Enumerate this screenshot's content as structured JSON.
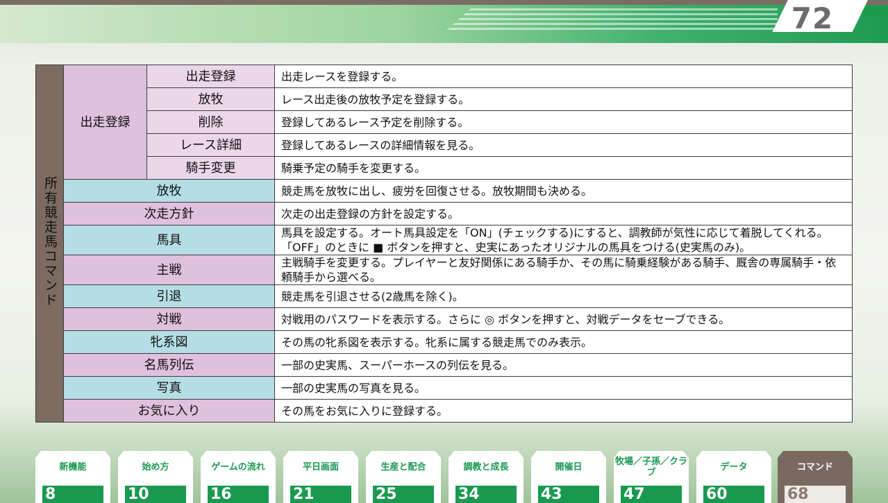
{
  "page_number": "72",
  "section_label": "所有競走馬コマンド",
  "group_label": "出走登録",
  "sub_rows": [
    {
      "name": "出走登録",
      "desc": "出走レースを登録する。"
    },
    {
      "name": "放牧",
      "desc": "レース出走後の放牧予定を登録する。"
    },
    {
      "name": "削除",
      "desc": "登録してあるレース予定を削除する。"
    },
    {
      "name": "レース詳細",
      "desc": "登録してあるレースの詳細情報を見る。"
    },
    {
      "name": "騎手変更",
      "desc": "騎乗予定の騎手を変更する。"
    }
  ],
  "rows": [
    {
      "name": "放牧",
      "desc": "競走馬を放牧に出し、疲労を回復させる。放牧期間も決める。"
    },
    {
      "name": "次走方針",
      "desc": "次走の出走登録の方針を設定する。"
    },
    {
      "name": "馬具",
      "desc": "馬具を設定する。オート馬具設定を「ON」(チェックする)にすると、調教師が気性に応じて着脱してくれる。「OFF」のときに ■ ボタンを押すと、史実にあったオリジナルの馬具をつける(史実馬のみ)。"
    },
    {
      "name": "主戦",
      "desc": "主戦騎手を変更する。プレイヤーと友好関係にある騎手か、その馬に騎乗経験がある騎手、厩舎の専属騎手・依頼騎手から選べる。"
    },
    {
      "name": "引退",
      "desc": "競走馬を引退させる(2歳馬を除く)。"
    },
    {
      "name": "対戦",
      "desc": "対戦用のパスワードを表示する。さらに ◎ ボタンを押すと、対戦データをセーブできる。"
    },
    {
      "name": "牝系図",
      "desc": "その馬の牝系図を表示する。牝系に属する競走馬でのみ表示。"
    },
    {
      "name": "名馬列伝",
      "desc": "一部の史実馬、スーパーホースの列伝を見る。"
    },
    {
      "name": "写真",
      "desc": "一部の史実馬の写真を見る。"
    },
    {
      "name": "お気に入り",
      "desc": "その馬をお気に入りに登録する。"
    }
  ],
  "nav_tabs": [
    {
      "label": "新機能",
      "page": "8"
    },
    {
      "label": "始め方",
      "page": "10"
    },
    {
      "label": "ゲームの流れ",
      "page": "16"
    },
    {
      "label": "平日画面",
      "page": "21"
    },
    {
      "label": "生産と配合",
      "page": "25"
    },
    {
      "label": "調教と成長",
      "page": "34"
    },
    {
      "label": "開催日",
      "page": "43"
    },
    {
      "label": "牧場／子孫／クラブ",
      "page": "47"
    },
    {
      "label": "データ",
      "page": "60"
    },
    {
      "label": "コマンド",
      "page": "68"
    }
  ]
}
